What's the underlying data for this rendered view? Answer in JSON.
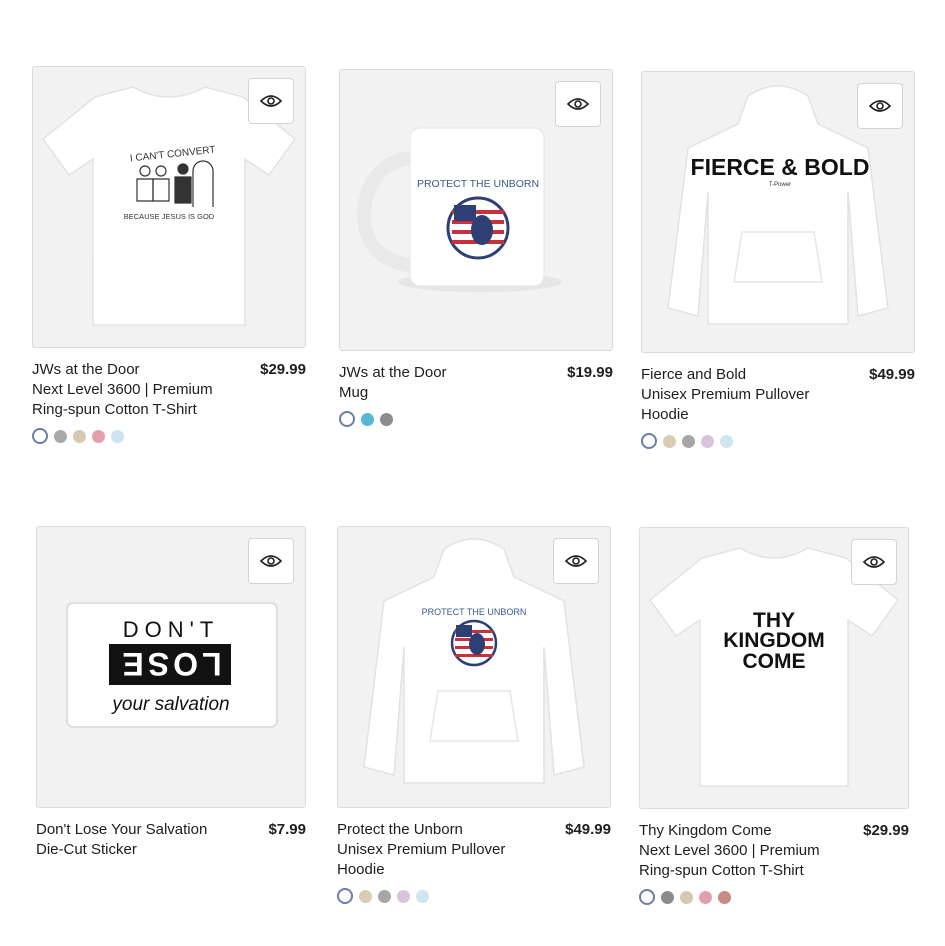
{
  "products": [
    {
      "title": "JWs at the Door",
      "subtitle": "Next Level 3600 | Premium Ring-spun Cotton T-Shirt",
      "price": "$29.99",
      "print_lines": [
        "I CAN'T CONVERT",
        "BECAUSE JESUS IS GOD"
      ],
      "swatches": [
        "#ffffff",
        "#a9a9a9",
        "#d6c9b2",
        "#e3a0ac",
        "#cfe3ef"
      ]
    },
    {
      "title": "JWs at the Door",
      "subtitle": "Mug",
      "price": "$19.99",
      "print_lines": [
        "PROTECT THE UNBORN"
      ],
      "swatches": [
        "#ffffff",
        "#56b7d6",
        "#8c8c8c"
      ]
    },
    {
      "title": "Fierce and Bold",
      "subtitle": "Unisex Premium Pullover Hoodie",
      "price": "$49.99",
      "print_lines": [
        "FIERCE & BOLD",
        "T-Power"
      ],
      "swatches": [
        "#ffffff",
        "#d8ccb4",
        "#a6a6a6",
        "#d9c3dc",
        "#cfe5ef"
      ]
    },
    {
      "title": "Don't Lose Your Salvation",
      "subtitle": "Die-Cut Sticker",
      "price": "$7.99",
      "print_lines": [
        "DON'T",
        "LOSE",
        "your salvation"
      ],
      "swatches": []
    },
    {
      "title": "Protect the Unborn",
      "subtitle": "Unisex Premium Pullover Hoodie",
      "price": "$49.99",
      "print_lines": [
        "PROTECT THE UNBORN"
      ],
      "swatches": [
        "#ffffff",
        "#d8ccb4",
        "#a6a6a6",
        "#d9c3dc",
        "#cfe5ef"
      ]
    },
    {
      "title": "Thy Kingdom Come",
      "subtitle": "Next Level 3600 | Premium Ring-spun Cotton T-Shirt",
      "price": "$29.99",
      "print_lines": [
        "THY",
        "KINGDOM",
        "COME"
      ],
      "swatches": [
        "#ffffff",
        "#8c8c8c",
        "#d6c9b2",
        "#e3a0ac",
        "#c98a82"
      ]
    }
  ],
  "icons": {
    "quick_view": "eye-icon"
  },
  "colors": {
    "selected_ring": "#6a7ea7",
    "image_bg": "#f2f2f3"
  }
}
